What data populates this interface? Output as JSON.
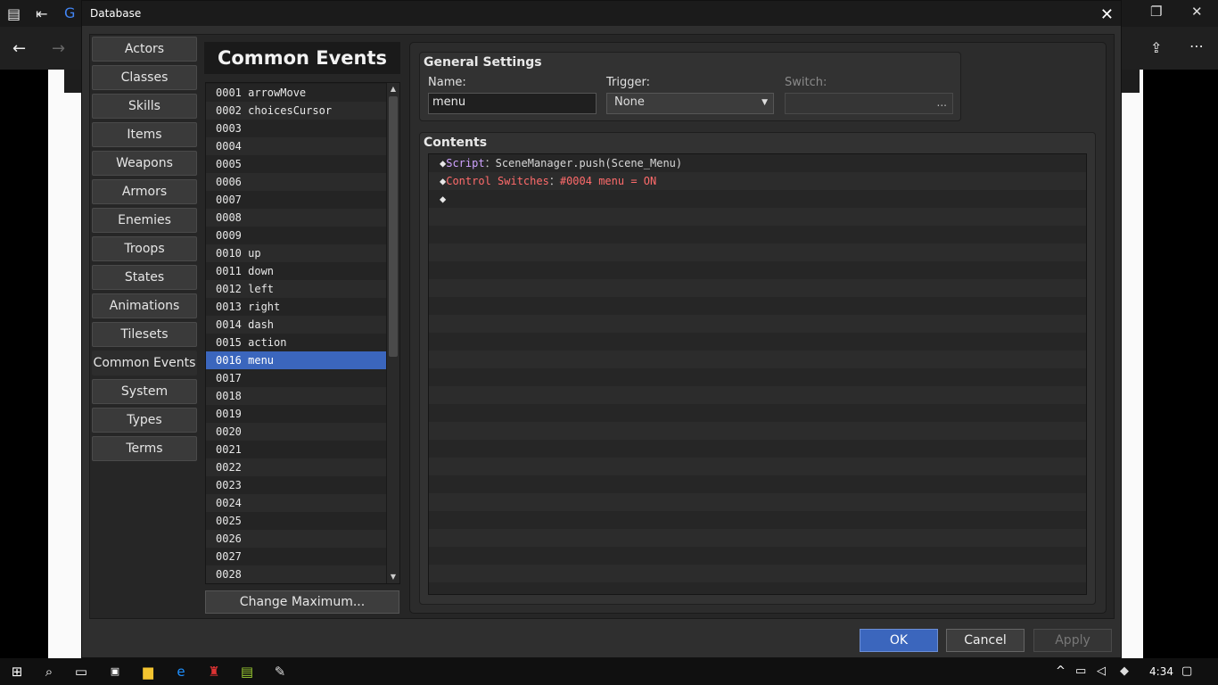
{
  "window": {
    "title": "Database"
  },
  "sidebar": {
    "items": [
      {
        "label": "Actors",
        "active": false
      },
      {
        "label": "Classes",
        "active": false
      },
      {
        "label": "Skills",
        "active": false
      },
      {
        "label": "Items",
        "active": false
      },
      {
        "label": "Weapons",
        "active": false
      },
      {
        "label": "Armors",
        "active": false
      },
      {
        "label": "Enemies",
        "active": false
      },
      {
        "label": "Troops",
        "active": false
      },
      {
        "label": "States",
        "active": false
      },
      {
        "label": "Animations",
        "active": false
      },
      {
        "label": "Tilesets",
        "active": false
      },
      {
        "label": "Common Events",
        "active": true
      },
      {
        "label": "System",
        "active": false
      },
      {
        "label": "Types",
        "active": false
      },
      {
        "label": "Terms",
        "active": false
      }
    ]
  },
  "list": {
    "header": "Common Events",
    "selected_index": 15,
    "items": [
      "0001 arrowMove",
      "0002 choicesCursor",
      "0003",
      "0004",
      "0005",
      "0006",
      "0007",
      "0008",
      "0009",
      "0010 up",
      "0011 down",
      "0012 left",
      "0013 right",
      "0014 dash",
      "0015 action",
      "0016 menu",
      "0017",
      "0018",
      "0019",
      "0020",
      "0021",
      "0022",
      "0023",
      "0024",
      "0025",
      "0026",
      "0027",
      "0028"
    ],
    "change_max_label": "Change Maximum..."
  },
  "general": {
    "title": "General Settings",
    "name_label": "Name:",
    "name_value": "menu",
    "trigger_label": "Trigger:",
    "trigger_value": "None",
    "switch_label": "Switch:",
    "switch_dots": "..."
  },
  "contents": {
    "title": "Contents",
    "commands": [
      {
        "name": "Script",
        "sep": "：",
        "value": "SceneManager.push(Scene_Menu)",
        "kind": "script"
      },
      {
        "name": "Control Switches",
        "sep": "：",
        "value": "#0004 menu = ON",
        "kind": "switch"
      },
      {
        "name": "",
        "sep": "",
        "value": "",
        "kind": "empty"
      }
    ],
    "diamond": "◆"
  },
  "footer": {
    "ok": "OK",
    "cancel": "Cancel",
    "apply": "Apply"
  },
  "taskbar": {
    "time": "4:34"
  }
}
